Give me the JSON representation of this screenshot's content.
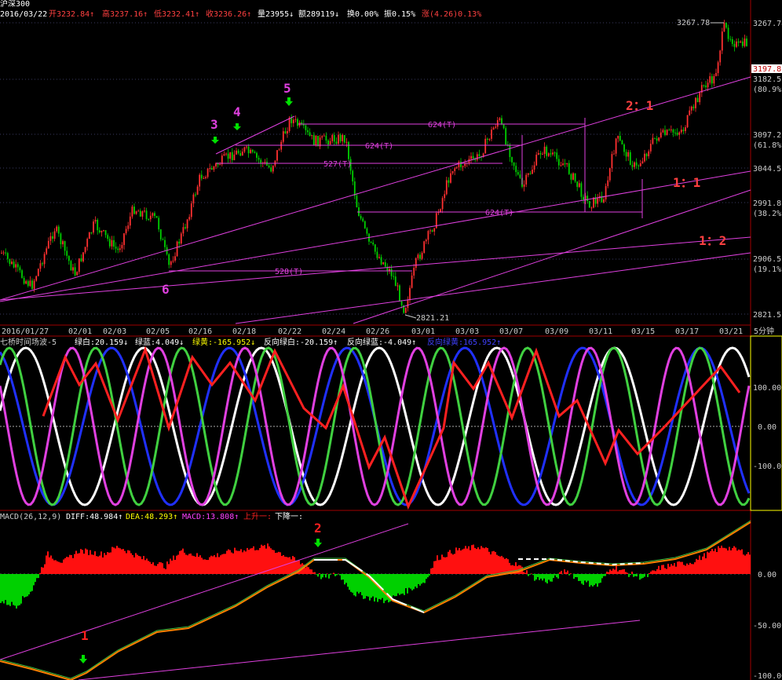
{
  "header": {
    "name": "沪深300",
    "date": "2016/03/22",
    "open": "开3232.84↑",
    "high": "高3237.16↑",
    "low": "低3232.41↑",
    "close": "收3236.26↑",
    "volume": "量23955↓",
    "amount": "额289119↓",
    "turnover": "换0.00%",
    "amplitude": "振0.15%",
    "change": "涨(4.26)0.13%"
  },
  "price_axis": {
    "labels": [
      "3267.78",
      "3197.8",
      "3182.5",
      "(80.9%)",
      "3097.2",
      "(61.8%)",
      "3044.5",
      "2991.8",
      "(38.2%)",
      "2906.5",
      "(19.1%)",
      "2821.5"
    ],
    "high_label": "3267.78",
    "low_label": "2821.21"
  },
  "price_annotations": {
    "marks": [
      "1",
      "2",
      "3",
      "4",
      "5",
      "6"
    ],
    "n3": "3",
    "n4": "4",
    "n5": "5",
    "n6": "6",
    "r21": "2：1",
    "r11": "1：1",
    "r12": "1：2",
    "seg1": "624(T)",
    "seg2": "624(T)",
    "seg3": "527(T)",
    "seg4": "624(T)",
    "seg5": "528(T)"
  },
  "date_axis": {
    "labels": [
      "2016/01/27",
      "02/01",
      "02/03",
      "02/05",
      "02/16",
      "02/18",
      "02/22",
      "02/24",
      "02/26",
      "03/01",
      "03/03",
      "03/07",
      "03/09",
      "03/11",
      "03/15",
      "03/17",
      "03/21"
    ],
    "period": "5分钟"
  },
  "wave_panel": {
    "title": "七桥时间场波-5",
    "w1": "绿白:20.159↓",
    "w2": "绿蓝:4.049↓",
    "w3": "绿黄:-165.952↓",
    "w4": "反向绿白:-20.159↑",
    "w5": "反向绿蓝:-4.049↑",
    "w6": "反向绿黄:165.952↑",
    "axis": [
      "100.00",
      "0.00",
      "-100.00"
    ]
  },
  "macd_panel": {
    "title": "MACD(26,12,9)",
    "diff": "DIFF:48.984↑",
    "dea": "DEA:48.293↑",
    "macd": "MACD:13.808↑",
    "up": "上升一:",
    "down": "下降一:",
    "axis": [
      "0.00",
      "-50.00",
      "-100.00"
    ],
    "mark1": "1",
    "mark2": "2"
  },
  "colors": {
    "up": "#ff3030",
    "down": "#00e000",
    "magenta": "#e040e0",
    "axis": "#c00000",
    "text_red": "#ff4040",
    "yellow": "#ffff00"
  }
}
